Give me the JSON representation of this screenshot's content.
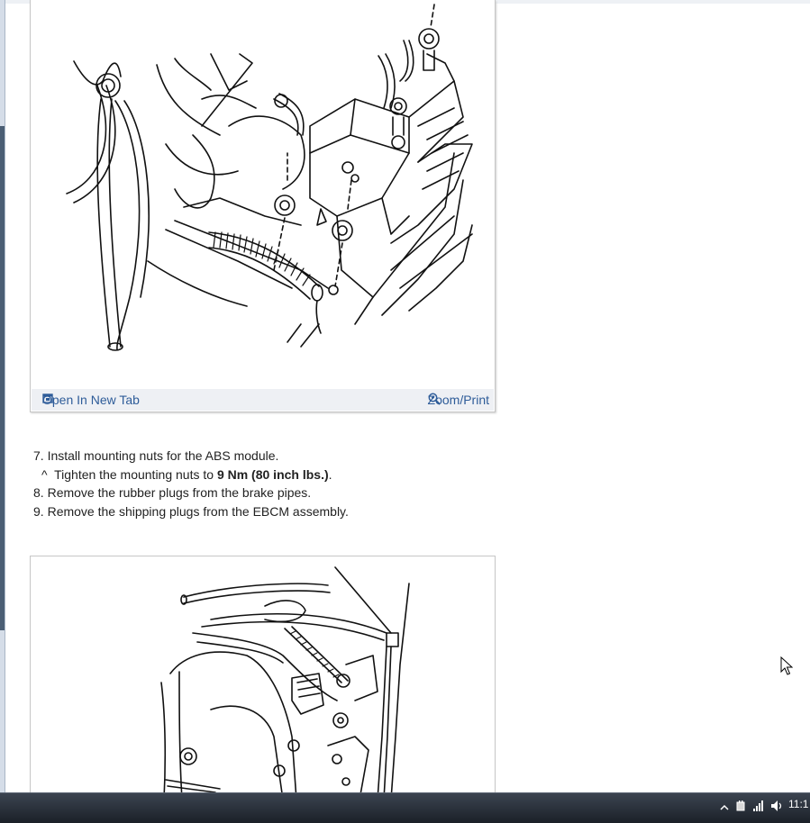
{
  "figure1": {
    "open_label": "Open In New Tab",
    "zoom_label": "Zoom/Print"
  },
  "steps": [
    {
      "number": "7.",
      "text": "Install mounting nuts for the ABS module."
    },
    {
      "number": "8.",
      "text": "Remove the rubber plugs from the brake pipes."
    },
    {
      "number": "9.",
      "text": "Remove the shipping plugs from the EBCM assembly."
    }
  ],
  "substep": {
    "marker": "^",
    "prefix": "Tighten the mounting nuts to ",
    "bold": "9 Nm (80 inch lbs.)",
    "suffix": "."
  },
  "taskbar": {
    "clock": "11:1",
    "tray_icons": [
      "chevron-up-icon",
      "power-plug-icon",
      "signal-icon",
      "speaker-icon"
    ]
  },
  "colors": {
    "link": "#2e5c99",
    "text": "#222222",
    "footer_bg": "#eef0f4",
    "taskbar": "#1b2028"
  },
  "icons": {
    "open": "open-new-tab-icon",
    "zoom": "magnifier-icon",
    "cursor": "mouse-pointer-icon"
  }
}
